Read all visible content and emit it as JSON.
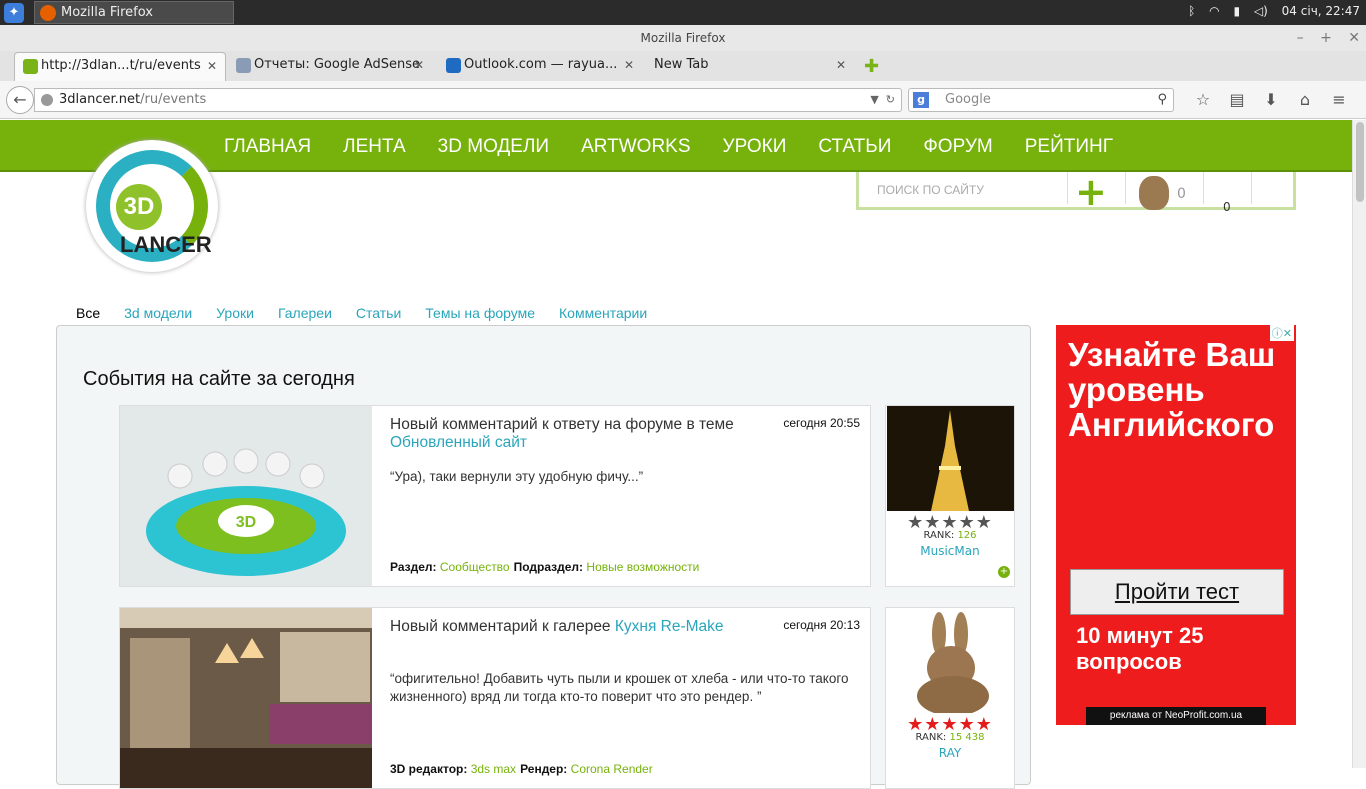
{
  "taskbar": {
    "app_label": "Mozilla Firefox",
    "clock": "04 січ, 22:47"
  },
  "window": {
    "title": "Mozilla Firefox"
  },
  "tabs": [
    {
      "label": "http://3dlan...t/ru/events",
      "active": true,
      "icon_color": "#7ab317"
    },
    {
      "label": "Отчеты: Google AdSense",
      "active": false,
      "icon_color": "#8a9bb5"
    },
    {
      "label": "Outlook.com — rayua...",
      "active": false,
      "icon_color": "#1f6bc2"
    },
    {
      "label": "New Tab",
      "active": false,
      "icon_color": "#e3e3e3"
    }
  ],
  "navbar": {
    "url_domain": "3dlancer.net",
    "url_path": "/ru/events",
    "search_placeholder": "Google"
  },
  "site": {
    "menu": [
      "ГЛАВНАЯ",
      "ЛЕНТА",
      "3D МОДЕЛИ",
      "ARTWORKS",
      "УРОКИ",
      "СТАТЬИ",
      "ФОРУМ",
      "РЕЙТИНГ"
    ],
    "logo_mark": "3D",
    "logo_text": "LANCER",
    "search_placeholder": "ПОИСК ПО САЙТУ",
    "counter_messages": "0",
    "counter_notifications": "0",
    "accent_color": "#76b20b",
    "link_color": "#2aa5bb"
  },
  "filters": [
    "Все",
    "3d модели",
    "Уроки",
    "Галереи",
    "Статьи",
    "Темы на форуме",
    "Комментарии"
  ],
  "panel": {
    "heading": "События на сайте за сегодня"
  },
  "events": [
    {
      "title_prefix": "Новый комментарий к ответу на форуме в теме",
      "title_link": "Обновленный сайт",
      "time": "сегодня 20:55",
      "quote": "“Ура), таки вернули эту удобную фичу...”",
      "meta_label_1": "Раздел:",
      "meta_value_1": "Сообщество",
      "meta_label_2": "Подраздел:",
      "meta_value_2": "Новые возможности",
      "user": {
        "stars": "★★★★★",
        "rank_label": "RANK:",
        "rank": "126",
        "name": "MusicMan",
        "star_color": "#555"
      }
    },
    {
      "title_prefix": "Новый комментарий к галерее",
      "title_link": "Кухня Re-Make",
      "time": "сегодня 20:13",
      "quote": "“офигительно! Добавить чуть пыли и крошек от хлеба - или что-то такого жизненного) вряд ли тогда кто-то поверит что это рендер. ”",
      "meta_label_1": "3D редактор:",
      "meta_value_1": "3ds max",
      "meta_label_2": "Рендер:",
      "meta_value_2": "Corona Render",
      "user": {
        "stars": "★★★★★",
        "rank_label": "RANK:",
        "rank": "15 438",
        "name": "RAY",
        "star_color": "#e31b1b"
      }
    }
  ],
  "ad": {
    "headline": "Узнайте Ваш уровень Английского",
    "button": "Пройти тест",
    "sub": "10 минут 25 вопросов",
    "footer": "реклама от NeoProfit.com.ua",
    "bg_color": "#ee1c1c"
  }
}
